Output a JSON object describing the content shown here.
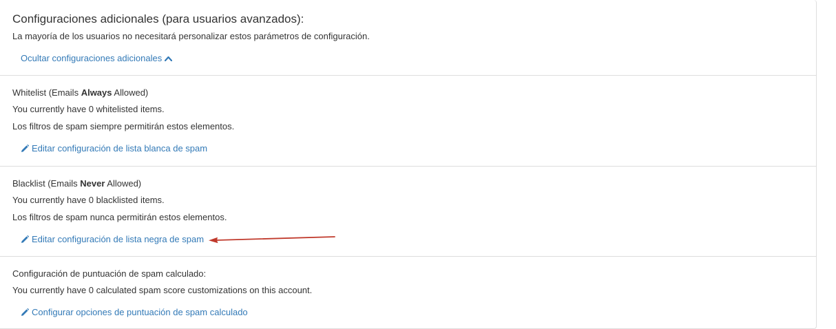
{
  "header": {
    "title": "Configuraciones adicionales (para usuarios avanzados):",
    "subtitle": "La mayoría de los usuarios no necesitará personalizar estos parámetros de configuración.",
    "toggle_link": "Ocultar configuraciones adicionales"
  },
  "whitelist": {
    "heading_prefix": "Whitelist (Emails ",
    "heading_bold": "Always",
    "heading_suffix": " Allowed)",
    "count_text": "You currently have 0 whitelisted items.",
    "description": "Los filtros de spam siempre permitirán estos elementos.",
    "edit_link": "Editar configuración de lista blanca de spam"
  },
  "blacklist": {
    "heading_prefix": "Blacklist (Emails ",
    "heading_bold": "Never",
    "heading_suffix": " Allowed)",
    "count_text": "You currently have 0 blacklisted items.",
    "description": "Los filtros de spam nunca permitirán estos elementos.",
    "edit_link": "Editar configuración de lista negra de spam"
  },
  "score": {
    "heading": "Configuración de puntuación de spam calculado:",
    "count_text": "You currently have 0 calculated spam score customizations on this account.",
    "config_link": "Configurar opciones de puntuación de spam calculado"
  },
  "colors": {
    "link": "#337ab7",
    "text": "#333333",
    "border": "#dddddd",
    "annotation_arrow": "#c0392b"
  },
  "icons": {
    "edit": "pencil-icon",
    "collapse": "chevron-up-icon"
  }
}
